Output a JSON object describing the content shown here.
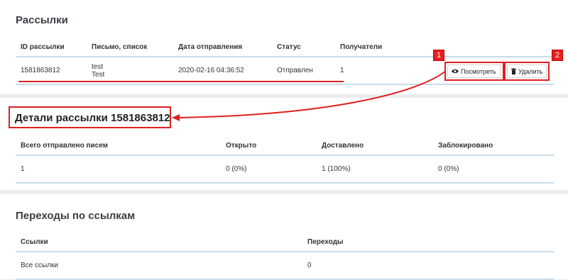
{
  "mailings": {
    "title": "Рассылки",
    "columns": [
      "ID рассылки",
      "Письмо, список",
      "Дата отправления",
      "Статус",
      "Получатели"
    ],
    "row": {
      "id": "1581863812",
      "letter": "test",
      "list": "Test",
      "date": "2020-02-16 04:36:52",
      "status": "Отправлен",
      "recipients": "1"
    },
    "view_button": "Посмотреть",
    "delete_button": "Удалить"
  },
  "annotations": {
    "badge1": "1",
    "badge2": "2"
  },
  "details": {
    "title": "Детали рассылки 1581863812",
    "columns": [
      "Всего отправлено писем",
      "Открыто",
      "Доставлено",
      "Заблокировано"
    ],
    "values": [
      "1",
      "0 (0%)",
      "1 (100%)",
      "0 (0%)"
    ]
  },
  "links": {
    "title": "Переходы по ссылкам",
    "columns": [
      "Ссылки",
      "Переходы"
    ],
    "values": [
      "Все ссылки",
      "0"
    ]
  },
  "colors": {
    "accent_red": "#e02020",
    "table_border": "#c9dbe9"
  },
  "icons": {
    "view": "eye-icon",
    "delete": "trash-icon"
  }
}
